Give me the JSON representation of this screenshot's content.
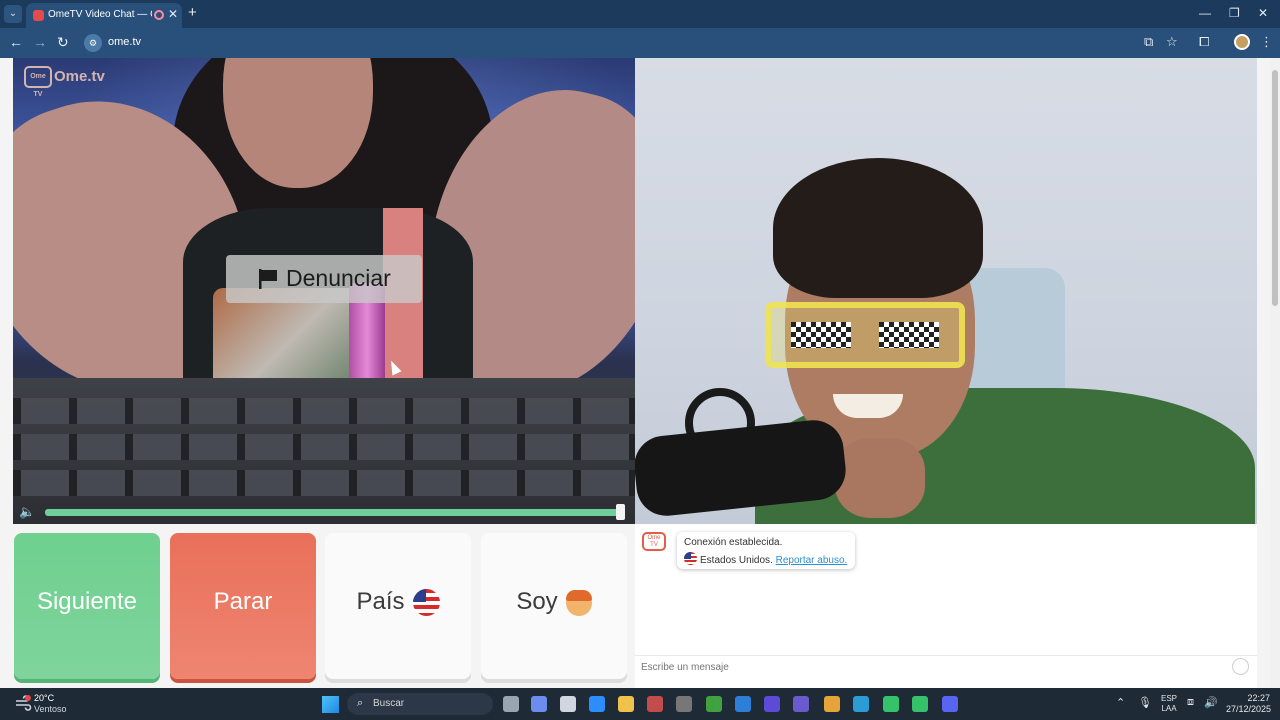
{
  "browser": {
    "tab_title": "OmeTV Video Chat — Omegle",
    "url": "ome.tv"
  },
  "page": {
    "logo_text": "Ome.tv",
    "logo_badge": "Ome TV",
    "report_label": "Denunciar",
    "buttons": {
      "next": "Siguiente",
      "stop": "Parar",
      "country": "País",
      "me": "Soy"
    },
    "volume_level": 1.0
  },
  "chat": {
    "logo_badge": "Ome TV",
    "status_line": "Conexión establecida.",
    "country_text": "Estados Unidos.",
    "report_link": "Reportar abuso.",
    "message_placeholder": "Escribe un mensaje"
  },
  "taskbar": {
    "weather_temp": "20°C",
    "weather_desc": "Ventoso",
    "search_label": "Buscar",
    "lang_top": "ESP",
    "lang_bottom": "LAA",
    "time": "22:27",
    "date": "27/12/2025",
    "app_colors": [
      "#9aa5b1",
      "#6d8cf0",
      "#cfd6df",
      "#2d8cff",
      "#f0c24b",
      "#c24b4b",
      "#777777",
      "#3fa23f",
      "#2d7fd6",
      "#5b4bd6",
      "#6a5acd",
      "#e4a43a",
      "#2d9bd6",
      "#36c26b",
      "#36c26b",
      "#5865f2"
    ]
  },
  "colors": {
    "next_green": "#6fd08f",
    "stop_red": "#e9705a",
    "link_blue": "#2d8fd1"
  }
}
